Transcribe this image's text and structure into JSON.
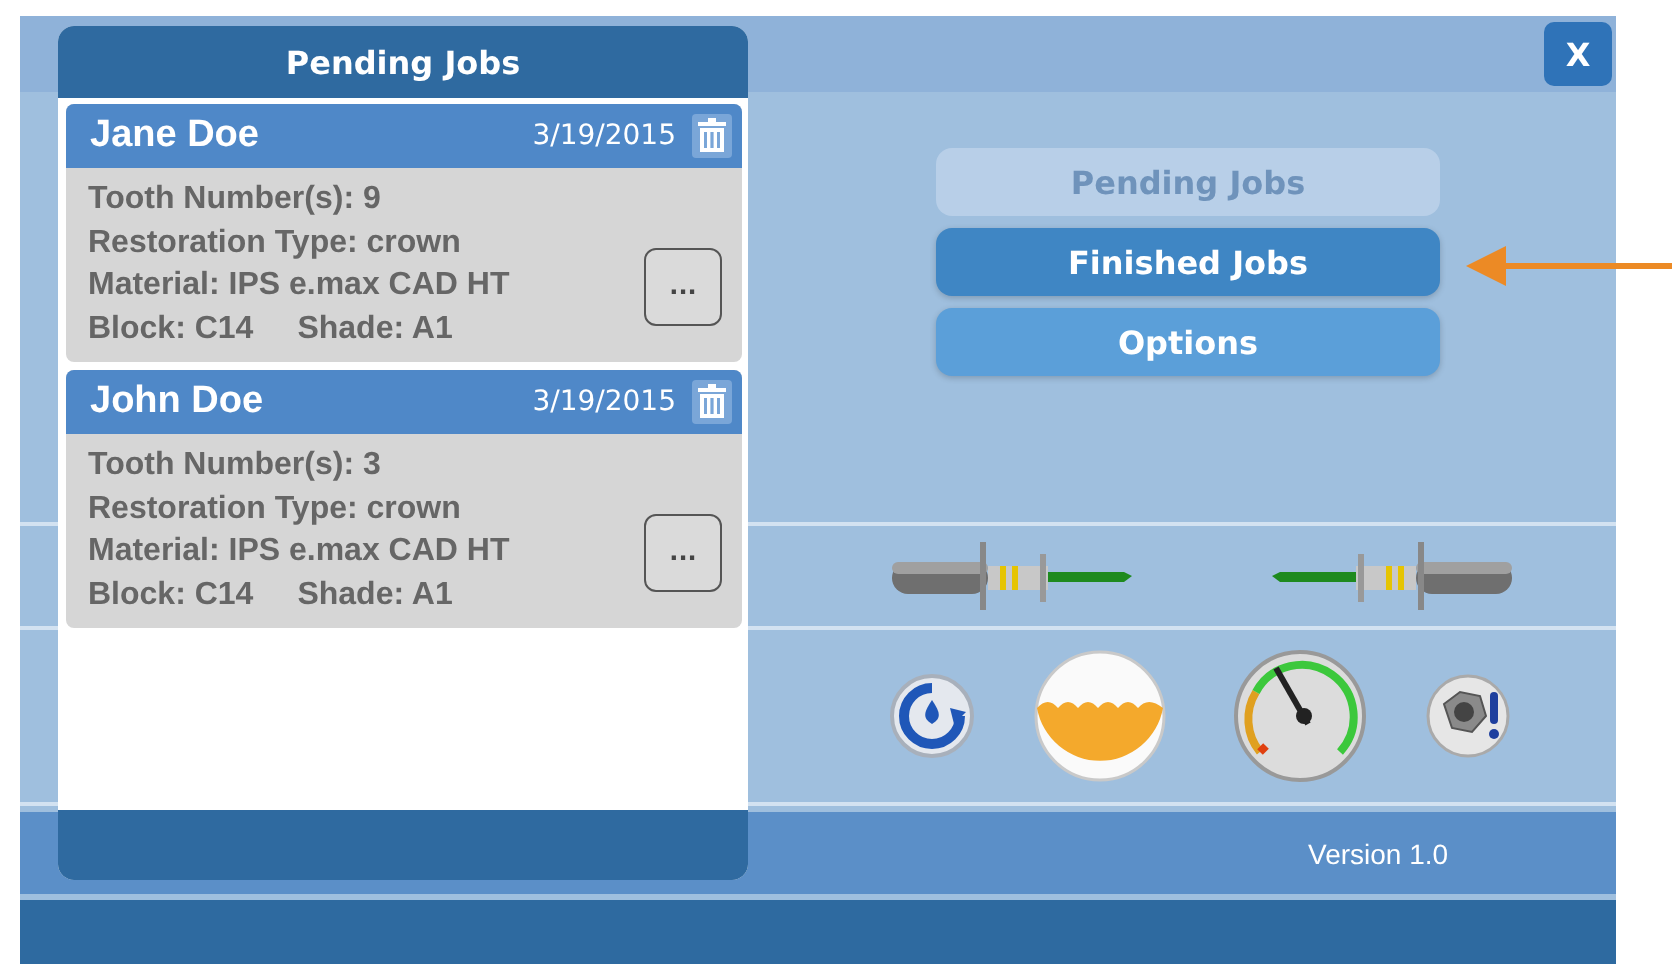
{
  "window": {
    "close_label": "X"
  },
  "pending_panel": {
    "title": "Pending Jobs",
    "jobs": [
      {
        "patient": "Jane Doe",
        "date": "3/19/2015",
        "tooth": "Tooth Number(s): 9",
        "restoration": "Restoration Type: crown",
        "material": "Material: IPS e.max CAD HT",
        "block": "Block: C14",
        "shade": "Shade: A1",
        "more_label": "..."
      },
      {
        "patient": "John Doe",
        "date": "3/19/2015",
        "tooth": "Tooth Number(s): 3",
        "restoration": "Restoration Type: crown",
        "material": "Material: IPS e.max CAD HT",
        "block": "Block: C14",
        "shade": "Shade: A1",
        "more_label": "..."
      }
    ]
  },
  "menu": [
    {
      "label": "Pending Jobs",
      "disabled": true,
      "highlighted": false
    },
    {
      "label": "Finished Jobs",
      "disabled": false,
      "highlighted": true
    },
    {
      "label": "Options",
      "disabled": false,
      "highlighted": false
    }
  ],
  "version": "Version 1.0"
}
